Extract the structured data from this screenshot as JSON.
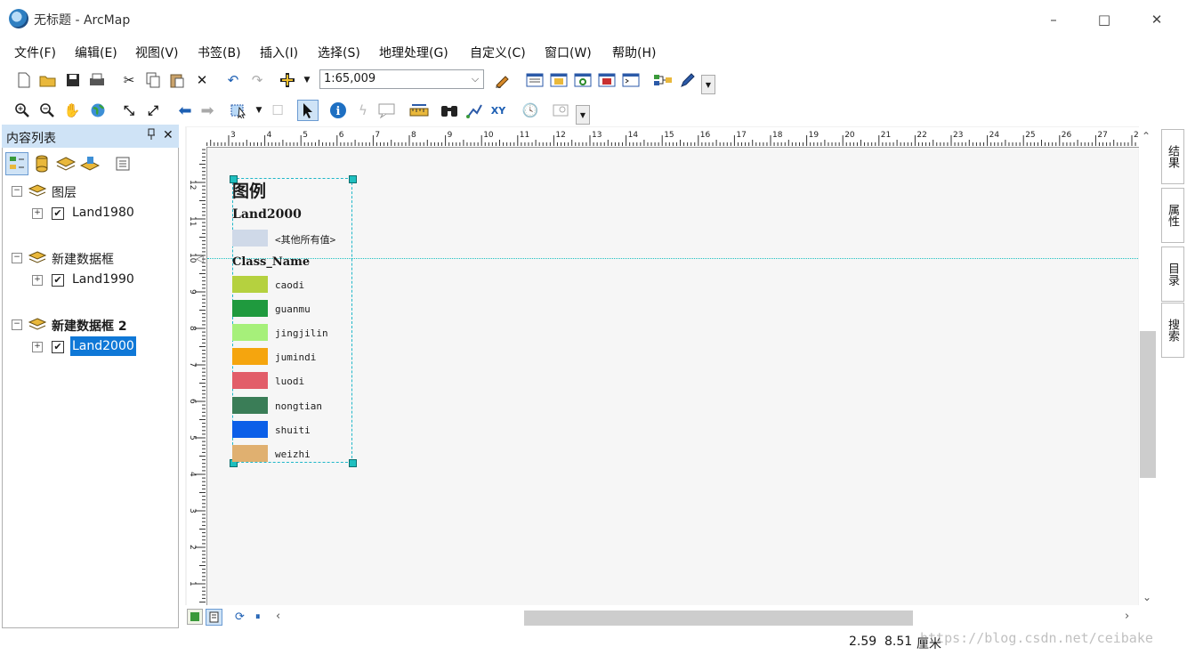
{
  "window": {
    "title": "无标题 - ArcMap",
    "minimize": "–",
    "maximize": "□",
    "close": "✕"
  },
  "menu": [
    "文件(F)",
    "编辑(E)",
    "视图(V)",
    "书签(B)",
    "插入(I)",
    "选择(S)",
    "地理处理(G)",
    "自定义(C)",
    "窗口(W)",
    "帮助(H)"
  ],
  "toolbar": {
    "scale": "1:65,009"
  },
  "toc": {
    "title": "内容列表",
    "pin": "ꟷ",
    "close": "✕",
    "frames": [
      {
        "name": "图层",
        "layer": "Land1980",
        "bold": false
      },
      {
        "name": "新建数据框",
        "layer": "Land1990",
        "bold": false
      },
      {
        "name": "新建数据框 2",
        "layer": "Land2000",
        "bold": true
      }
    ]
  },
  "ruler": {
    "h_ticks": [
      "3",
      "4",
      "5",
      "6",
      "7",
      "8",
      "9",
      "10",
      "11",
      "12",
      "13",
      "14",
      "15",
      "16",
      "17",
      "18",
      "19",
      "20",
      "21",
      "22",
      "23",
      "24",
      "25",
      "26",
      "27",
      "2"
    ],
    "v_ticks": [
      "12",
      "11",
      "10",
      "9",
      "8",
      "7",
      "6",
      "5",
      "4",
      "3",
      "2",
      "1"
    ]
  },
  "legend": {
    "title": "图例",
    "layer1": "Land2000",
    "other": "<其他所有值>",
    "other_color": "#cfd9e8",
    "field": "Class_Name",
    "items": [
      {
        "label": "caodi",
        "color": "#b5d13f"
      },
      {
        "label": "guanmu",
        "color": "#1f9a3e"
      },
      {
        "label": "jingjilin",
        "color": "#a6f07a"
      },
      {
        "label": "jumindi",
        "color": "#f5a50e"
      },
      {
        "label": "luodi",
        "color": "#e25d69"
      },
      {
        "label": "nongtian",
        "color": "#3a7d57"
      },
      {
        "label": "shuiti",
        "color": "#0b5fe8"
      },
      {
        "label": "weizhi",
        "color": "#e0b070"
      }
    ]
  },
  "dock": [
    "结果",
    "属性",
    "目录",
    "搜索"
  ],
  "status": {
    "x": "2.59",
    "y": "8.51",
    "unit": "厘米"
  },
  "watermark": "https://blog.csdn.net/ceibake"
}
